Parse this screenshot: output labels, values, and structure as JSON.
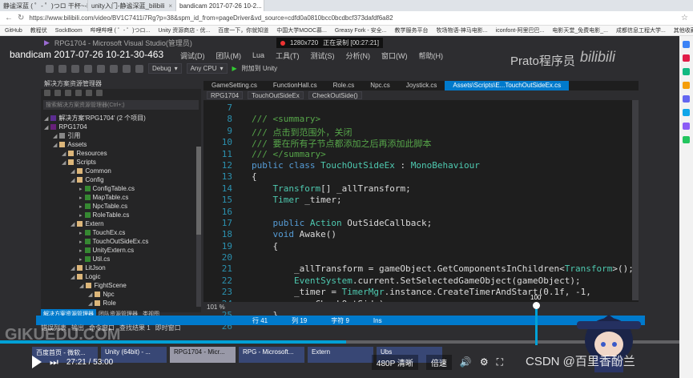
{
  "browser": {
    "tabs": [
      {
        "label": "静谧深蓝 ( ゜- ゜)つロ 干杯~-bili..."
      },
      {
        "label": "unity入门-静谧深蓝_bilibili"
      },
      {
        "label": "bandicam 2017-07-26 10-2...",
        "active": true
      }
    ],
    "url": "https://www.bilibili.com/video/BV1C7411i7Rg?p=38&spm_id_from=pageDriver&vd_source=cdfd0a0810bcc0bcdbcf373dafdf6a82",
    "bookmarks": [
      "GitHub",
      "教程伏",
      "SockBoom",
      "哔哩哔哩 ( ゜- ゜)つロ...",
      "Unity 资源商店 - 优...",
      "百度一下，你就知道",
      "中国大学MOOC慕...",
      "Greasy Fork - 安全...",
      "教学服务平台",
      "牧场物语-神马电影...",
      "iconfont-阿里巴巴...",
      "电影天堂_免费电影_...",
      "成都信息工程大学...",
      "其他收藏夹"
    ]
  },
  "video": {
    "watermark": "bandicam 2017-07-26 10-21-30-463",
    "vs_title": "RPG1704 - Microsoft Visual Studio(管理员)",
    "recorder": {
      "resolution": "1280x720",
      "status": "正在录制 [00:27:21]"
    },
    "prato": "Prato程序员",
    "bili": "bilibili",
    "menu": [
      "调试(D)",
      "团队(M)",
      "Lua",
      "工具(T)",
      "测试(S)",
      "分析(N)",
      "窗口(W)",
      "帮助(H)"
    ],
    "toolbar": {
      "config": "Debug",
      "platform": "Any CPU",
      "attach": "附加到 Unity"
    },
    "solution_explorer": {
      "title": "解决方案资源管理器",
      "search": "搜索解决方案资源管理器(Ctrl+;)",
      "tree": [
        {
          "label": "解决方案'RPG1704' (2 个项目)",
          "level": 0,
          "icon": "sol"
        },
        {
          "label": "RPG1704",
          "level": 0,
          "icon": "proj"
        },
        {
          "label": "引用",
          "level": 1,
          "icon": "ref"
        },
        {
          "label": "Assets",
          "level": 1,
          "icon": "folder"
        },
        {
          "label": "Resources",
          "level": 2,
          "icon": "folder"
        },
        {
          "label": "Scripts",
          "level": 2,
          "icon": "folder"
        },
        {
          "label": "Common",
          "level": 3,
          "icon": "folder"
        },
        {
          "label": "Config",
          "level": 3,
          "icon": "folder"
        },
        {
          "label": "ConfigTable.cs",
          "level": 4,
          "icon": "cs"
        },
        {
          "label": "MapTable.cs",
          "level": 4,
          "icon": "cs"
        },
        {
          "label": "NpcTable.cs",
          "level": 4,
          "icon": "cs"
        },
        {
          "label": "RoleTable.cs",
          "level": 4,
          "icon": "cs"
        },
        {
          "label": "Extern",
          "level": 3,
          "icon": "folder"
        },
        {
          "label": "TouchEx.cs",
          "level": 4,
          "icon": "cs"
        },
        {
          "label": "TouchOutSideEx.cs",
          "level": 4,
          "icon": "cs"
        },
        {
          "label": "UnityExtern.cs",
          "level": 4,
          "icon": "cs"
        },
        {
          "label": "Util.cs",
          "level": 4,
          "icon": "cs"
        },
        {
          "label": "LitJson",
          "level": 3,
          "icon": "folder"
        },
        {
          "label": "Logic",
          "level": 3,
          "icon": "folder"
        },
        {
          "label": "FightScene",
          "level": 4,
          "icon": "folder"
        },
        {
          "label": "Npc",
          "level": 5,
          "icon": "folder"
        },
        {
          "label": "Role",
          "level": 5,
          "icon": "folder"
        }
      ],
      "tabs": [
        "解决方案资源管理器",
        "团队资源管理器",
        "类视图"
      ]
    },
    "doc_tabs": [
      "GameSetting.cs",
      "FunctionHall.cs",
      "Role.cs",
      "Npc.cs",
      "Joystick.cs",
      "Assets\\Scripts\\E...TouchOutSideEx.cs"
    ],
    "navbar": {
      "project": "RPG1704",
      "class": "TouchOutSideEx",
      "member": "CheckOutSide()"
    },
    "code": [
      {
        "n": "7",
        "t": ""
      },
      {
        "n": "8",
        "t": "/// <summary>",
        "k": "com"
      },
      {
        "n": "9",
        "t": "/// 点击到范围外，关闭",
        "k": "com"
      },
      {
        "n": "10",
        "t": "/// 要在所有子节点都添加之后再添加此脚本",
        "k": "com"
      },
      {
        "n": "11",
        "t": "/// </summary>",
        "k": "com"
      },
      {
        "n": "12",
        "t": "public class TouchOutSideEx : MonoBehaviour",
        "k": "decl"
      },
      {
        "n": "13",
        "t": "{"
      },
      {
        "n": "14",
        "t": "    Transform[] _allTransform;"
      },
      {
        "n": "15",
        "t": "    Timer _timer;"
      },
      {
        "n": "16",
        "t": ""
      },
      {
        "n": "17",
        "t": "    public Action OutSideCallback;"
      },
      {
        "n": "18",
        "t": "    void Awake()"
      },
      {
        "n": "19",
        "t": "    {"
      },
      {
        "n": "20",
        "t": ""
      },
      {
        "n": "21",
        "t": "        _allTransform = gameObject.GetComponentsInChildren<Transform>();"
      },
      {
        "n": "22",
        "t": "        EventSystem.current.SetSelectedGameObject(gameObject);"
      },
      {
        "n": "23",
        "t": "        _timer = TimerMgr.instance.CreateTimerAndStart(0.1f, -1,"
      },
      {
        "n": "24",
        "t": "            CheckOutSide);"
      },
      {
        "n": "25",
        "t": "    }"
      },
      {
        "n": "26",
        "t": ""
      }
    ],
    "zoom": "101 %",
    "status": {
      "line": "行 41",
      "col": "列 19",
      "ch": "字符 9",
      "ins": "Ins"
    },
    "bottom_tabs": [
      "错误列表",
      "输出",
      "命令窗口",
      "查找结果 1",
      "即时窗口"
    ],
    "volume": "100",
    "volume_level": 1.0,
    "progress_fraction": 0.51,
    "taskbar": [
      "百度首页 - 微软...",
      "Unity (64bit) - ...",
      "RPG1704 - Micr...",
      "RPG - Microsoft...",
      "Extern",
      "Ubs"
    ],
    "time": "27:21 / 53:00",
    "quality": "480P 清晰",
    "speed": "倍速",
    "gikuedu": "GIKUEDU.COM",
    "csdn": "CSDN @百里香酚兰"
  }
}
